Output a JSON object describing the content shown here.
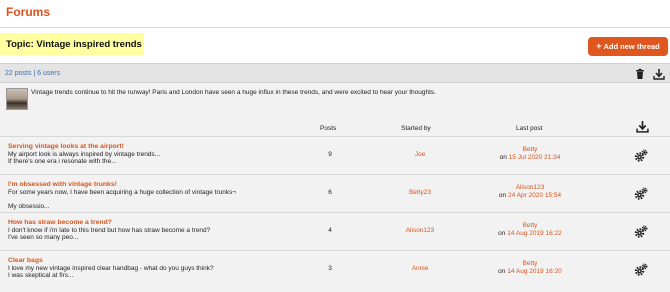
{
  "header": {
    "title": "Forums"
  },
  "topic": {
    "label": "Topic: Vintage inspired trends"
  },
  "actions": {
    "add_thread_label": "Add new thread",
    "add_icon": "+"
  },
  "summary": {
    "counts": "22 posts | 6 users"
  },
  "description": {
    "text": "Vintage trends continue to hit the runway! Paris and London have seen a huge influx in these trends, and were excited to hear your thoughts."
  },
  "columns": {
    "posts": "Posts",
    "started_by": "Started by",
    "last_post": "Last post"
  },
  "threads": [
    {
      "title": "Serving vintage looks at the airport!",
      "excerpt1": "My airport look is always inspired by vintage trends...",
      "excerpt2": "If there's one era i resonate with the...",
      "excerpt3": "",
      "posts": "9",
      "starter": "Joe",
      "last_user": "Betty",
      "last_on": "on",
      "last_date": "15 Jul 2020 21:34"
    },
    {
      "title": "I'm obsessed with vintage trunks!",
      "excerpt1": "For some years now, I have been acquiring a huge collection of vintage trunks¬",
      "excerpt2": "",
      "excerpt3": "My obsessio...",
      "posts": "6",
      "starter": "Betty23",
      "last_user": "Alison123",
      "last_on": "on",
      "last_date": "24 Apr 2020 15:54"
    },
    {
      "title": "How has straw become a trend?",
      "excerpt1": "I don't know if i'm late to this trend but how has straw become a trend?",
      "excerpt2": "I've seen so many peo...",
      "excerpt3": "",
      "posts": "4",
      "starter": "Alison123",
      "last_user": "Betty",
      "last_on": "on",
      "last_date": "14 Aug 2019 16:22"
    },
    {
      "title": "Clear bags",
      "excerpt1": "I love my new vintage inspired clear handbag - what do you guys think?",
      "excerpt2": "I was skeptical at firs...",
      "excerpt3": "",
      "posts": "3",
      "starter": "Annie",
      "last_user": "Betty",
      "last_on": "on",
      "last_date": "14 Aug 2019 16:20"
    }
  ],
  "icons": {
    "delete": "trash-icon",
    "download": "download-icon",
    "settings": "gear-icon"
  },
  "colors": {
    "accent": "#d9541e",
    "highlight": "#ffffa0",
    "link": "#3b6fb6"
  }
}
